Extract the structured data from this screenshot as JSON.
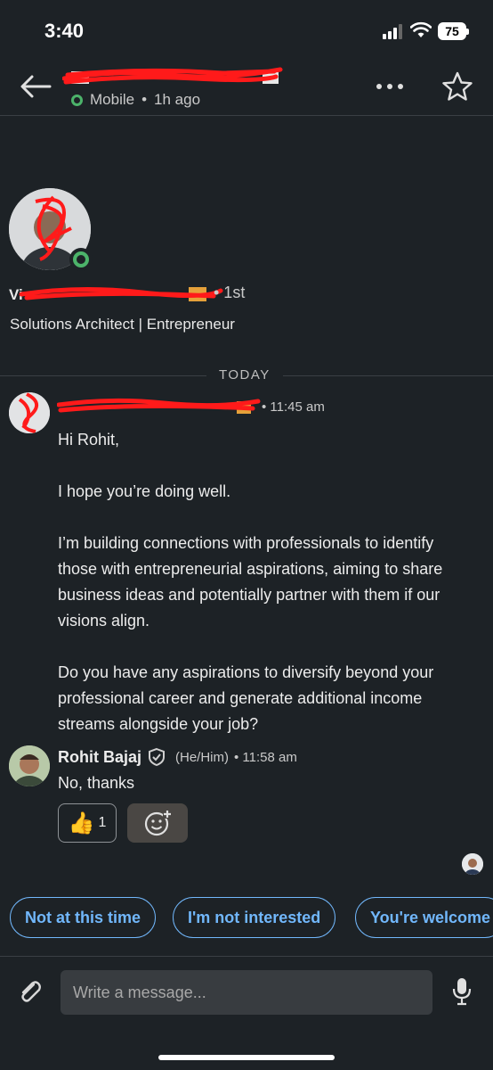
{
  "status_bar": {
    "time": "3:40",
    "battery": "75"
  },
  "header": {
    "presence": "Mobile",
    "separator": "•",
    "last_active": "1h ago"
  },
  "profile": {
    "degree": "• 1st",
    "headline": "Solutions Architect | Entrepreneur"
  },
  "divider": {
    "label": "TODAY"
  },
  "messages": [
    {
      "time": "• 11:45 am",
      "paragraphs": [
        "Hi Rohit,",
        "I hope you’re doing well.",
        "I’m building connections with professionals to identify those with entrepreneurial aspirations, aiming to share business ideas and potentially partner with them if our visions align.",
        "Do you have any aspirations to diversify beyond your professional career and generate additional income streams alongside your job?"
      ]
    },
    {
      "sender": "Rohit Bajaj",
      "pronouns": "(He/Him)",
      "time": "• 11:58 am",
      "text": "No, thanks",
      "reaction": {
        "emoji": "👍",
        "count": "1"
      }
    }
  ],
  "smart_replies": [
    "Not at this time",
    "I'm not interested",
    "You're welcome"
  ],
  "composer": {
    "placeholder": "Write a message..."
  },
  "colors": {
    "background": "#1d2226",
    "accent": "#71b7fb",
    "online": "#4cb36a",
    "redaction": "#ff0000"
  }
}
